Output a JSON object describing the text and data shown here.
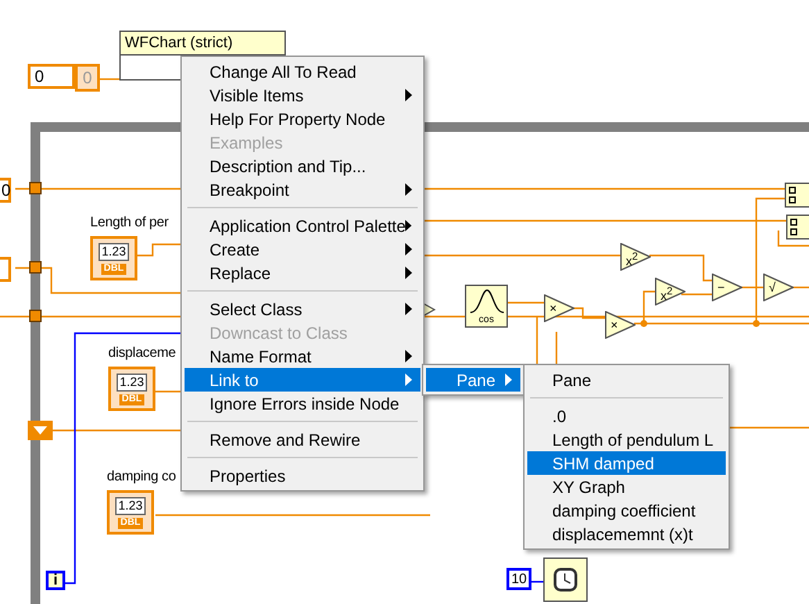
{
  "diagram": {
    "numeric_constant": {
      "value": "0"
    },
    "indicator": {
      "value": "0"
    },
    "property_node": {
      "title": "WFChart (strict)"
    },
    "left_constant": {
      "value": "0"
    },
    "controls": [
      {
        "label": "Length of per",
        "value": "1.23",
        "type": "DBL"
      },
      {
        "label": "displaceme",
        "value": "1.23",
        "type": "DBL"
      },
      {
        "label": "damping co",
        "value": "1.23",
        "type": "DBL"
      }
    ],
    "iteration_terminal": "i",
    "wait_constant": "10",
    "cos_node": {
      "label": "cos"
    },
    "function_nodes": [
      {
        "symbol": "x$^{2}$"
      },
      {
        "symbol": "x$^{2}$"
      },
      {
        "symbol": "×"
      },
      {
        "symbol": "×"
      },
      {
        "symbol": "−"
      },
      {
        "symbol": "√"
      }
    ]
  },
  "context_menu": {
    "items": [
      {
        "kind": "item",
        "label": "Change All To Read",
        "disabled": false,
        "submenu": false,
        "selected": false
      },
      {
        "kind": "item",
        "label": "Visible Items",
        "disabled": false,
        "submenu": true,
        "selected": false
      },
      {
        "kind": "item",
        "label": "Help For Property Node",
        "disabled": false,
        "submenu": false,
        "selected": false
      },
      {
        "kind": "item",
        "label": "Examples",
        "disabled": true,
        "submenu": false,
        "selected": false
      },
      {
        "kind": "item",
        "label": "Description and Tip...",
        "disabled": false,
        "submenu": false,
        "selected": false
      },
      {
        "kind": "item",
        "label": "Breakpoint",
        "disabled": false,
        "submenu": true,
        "selected": false
      },
      {
        "kind": "separator"
      },
      {
        "kind": "item",
        "label": "Application Control Palette",
        "disabled": false,
        "submenu": true,
        "selected": false
      },
      {
        "kind": "item",
        "label": "Create",
        "disabled": false,
        "submenu": true,
        "selected": false
      },
      {
        "kind": "item",
        "label": "Replace",
        "disabled": false,
        "submenu": true,
        "selected": false
      },
      {
        "kind": "separator"
      },
      {
        "kind": "item",
        "label": "Select Class",
        "disabled": false,
        "submenu": true,
        "selected": false
      },
      {
        "kind": "item",
        "label": "Downcast to Class",
        "disabled": true,
        "submenu": false,
        "selected": false
      },
      {
        "kind": "item",
        "label": "Name Format",
        "disabled": false,
        "submenu": true,
        "selected": false
      },
      {
        "kind": "item",
        "label": "Link to",
        "disabled": false,
        "submenu": true,
        "selected": true
      },
      {
        "kind": "item",
        "label": "Ignore Errors inside Node",
        "disabled": false,
        "submenu": false,
        "selected": false
      },
      {
        "kind": "separator"
      },
      {
        "kind": "item",
        "label": "Remove and Rewire",
        "disabled": false,
        "submenu": false,
        "selected": false
      },
      {
        "kind": "separator"
      },
      {
        "kind": "item",
        "label": "Properties",
        "disabled": false,
        "submenu": false,
        "selected": false
      }
    ]
  },
  "link_submenu": {
    "items": [
      {
        "label": "Pane",
        "submenu": true,
        "selected": true
      }
    ]
  },
  "pane_submenu": {
    "header": "Pane",
    "items": [
      {
        "label": ".0",
        "selected": false
      },
      {
        "label": "Length of pendulum L",
        "selected": false
      },
      {
        "label": "SHM damped",
        "selected": true
      },
      {
        "label": "XY Graph",
        "selected": false
      },
      {
        "label": "damping coefficient",
        "selected": false
      },
      {
        "label": "displacememnt (x)t",
        "selected": false
      }
    ]
  }
}
